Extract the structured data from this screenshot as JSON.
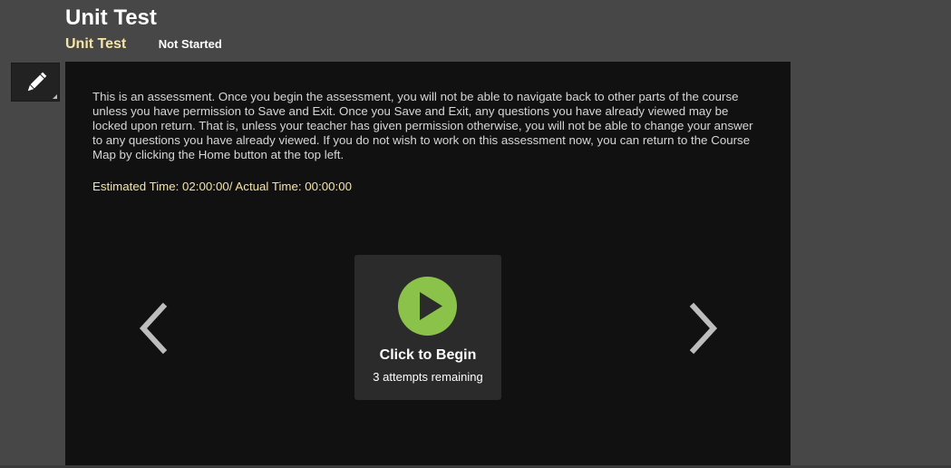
{
  "header": {
    "title": "Unit Test",
    "subtitle": "Unit Test",
    "status": "Not Started"
  },
  "toolbar": {
    "edit_icon": "pencil-icon"
  },
  "content": {
    "intro": "This is an assessment. Once you begin the assessment, you will not be able to navigate back to other parts of the course unless you have permission to Save and Exit. Once you Save and Exit, any questions you have already viewed may be locked upon return. That is, unless your teacher has given permission otherwise, you will not be able to change your answer to any questions you have already viewed. If you do not wish to work on this assessment now, you can return to the Course Map by clicking the Home button at the top left.",
    "time_info": "Estimated Time: 02:00:00/ Actual Time: 00:00:00",
    "begin": {
      "label": "Click to Begin",
      "attempts": "3 attempts remaining",
      "icon": "play-icon"
    },
    "nav": {
      "prev_icon": "chevron-left-icon",
      "next_icon": "chevron-right-icon"
    }
  },
  "colors": {
    "page_bg": "#474747",
    "panel_bg": "#111111",
    "card_bg": "#2b2b2b",
    "accent_yellow": "#f4e4a6",
    "play_green": "#8bc34a",
    "arrow_gray": "#bdbdbd"
  }
}
